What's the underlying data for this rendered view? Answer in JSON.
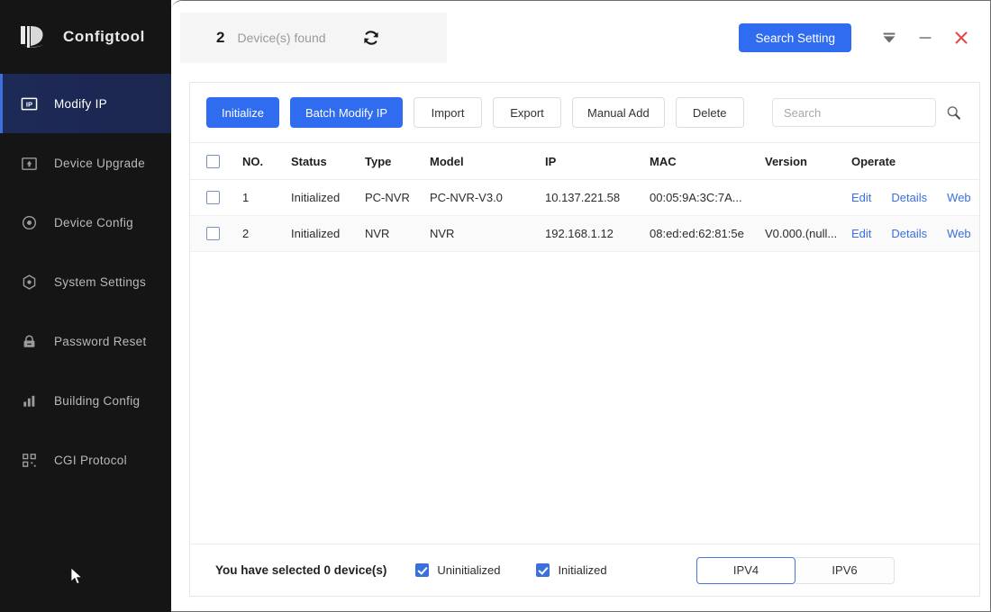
{
  "app": {
    "brand": "Configtool",
    "logo_icon": "dahua-logo-icon"
  },
  "sidebar": {
    "items": [
      {
        "label": "Modify IP",
        "icon": "ip-box-icon",
        "active": true
      },
      {
        "label": "Device Upgrade",
        "icon": "upload-box-icon",
        "active": false
      },
      {
        "label": "Device Config",
        "icon": "target-icon",
        "active": false
      },
      {
        "label": "System Settings",
        "icon": "hex-gear-icon",
        "active": false
      },
      {
        "label": "Password Reset",
        "icon": "lock-icon",
        "active": false
      },
      {
        "label": "Building Config",
        "icon": "bar-chart-icon",
        "active": false
      },
      {
        "label": "CGI Protocol",
        "icon": "qr-grid-icon",
        "active": false
      }
    ]
  },
  "topbar": {
    "found_count": "2",
    "found_label": "Device(s) found",
    "refresh_icon": "refresh-icon",
    "search_setting_label": "Search Setting",
    "tray_icon": "minimize-to-tray-icon",
    "minimize_icon": "minimize-icon",
    "close_icon": "close-icon"
  },
  "toolbar": {
    "buttons": [
      {
        "label": "Initialize",
        "primary": true
      },
      {
        "label": "Batch Modify IP",
        "primary": true
      },
      {
        "label": "Import",
        "primary": false
      },
      {
        "label": "Export",
        "primary": false
      },
      {
        "label": "Manual Add",
        "primary": false
      },
      {
        "label": "Delete",
        "primary": false
      }
    ],
    "search_value": "",
    "search_placeholder": "Search",
    "search_icon": "magnifier-icon"
  },
  "table": {
    "select_all_checked": false,
    "columns": [
      "NO.",
      "Status",
      "Type",
      "Model",
      "IP",
      "MAC",
      "Version",
      "Operate"
    ],
    "rows": [
      {
        "checked": false,
        "no": "1",
        "status": "Initialized",
        "type": "PC-NVR",
        "model": "PC-NVR-V3.0",
        "ip": "10.137.221.58",
        "mac": "00:05:9A:3C:7A...",
        "version": "",
        "operate": [
          "Edit",
          "Details",
          "Web"
        ]
      },
      {
        "checked": false,
        "no": "2",
        "status": "Initialized",
        "type": "NVR",
        "model": "NVR",
        "ip": "192.168.1.12",
        "mac": "08:ed:ed:62:81:5e",
        "version": "V0.000.(null...",
        "operate": [
          "Edit",
          "Details",
          "Web"
        ]
      }
    ]
  },
  "footer": {
    "selected_text": "You have selected 0  device(s)",
    "filters": [
      {
        "label": "Uninitialized",
        "checked": true
      },
      {
        "label": "Initialized",
        "checked": true
      }
    ],
    "ip_toggle": {
      "options": [
        "IPV4",
        "IPV6"
      ],
      "selected": "IPV4"
    }
  },
  "colors": {
    "accent": "#2f6cf0",
    "link": "#3a6fe0",
    "sidebar_bg": "#151515",
    "sidebar_active": "#1d2a56",
    "close_red": "#e04b4b",
    "panel_gray": "#f5f5f5"
  }
}
